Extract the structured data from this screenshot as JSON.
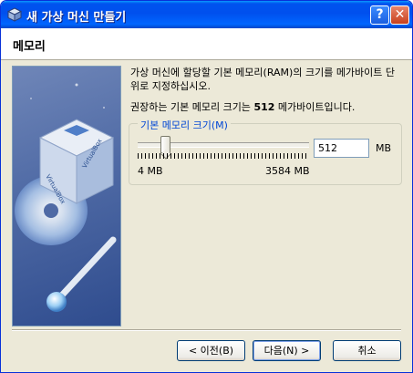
{
  "window": {
    "title": "새 가상 머신 만들기",
    "help_glyph": "?",
    "close_glyph": "✕"
  },
  "page": {
    "title": "메모리",
    "description": "가상 머신에 할당할 기본 메모리(RAM)의 크기를 메가바이트 단위로 지정하십시오.",
    "recommend_prefix": "권장하는 기본 메모리 크기는 ",
    "recommend_value": "512",
    "recommend_suffix": " 메가바이트입니다."
  },
  "memory": {
    "group_label": "기본 메모리 크기(M)",
    "min_label": "4 MB",
    "max_label": "3584 MB",
    "value": "512",
    "unit": "MB",
    "slider_fraction": 0.142
  },
  "buttons": {
    "back": "< 이전(B)",
    "next": "다음(N) >",
    "cancel": "취소"
  },
  "icons": [
    "virtualbox-icon",
    "help-icon",
    "close-icon"
  ]
}
